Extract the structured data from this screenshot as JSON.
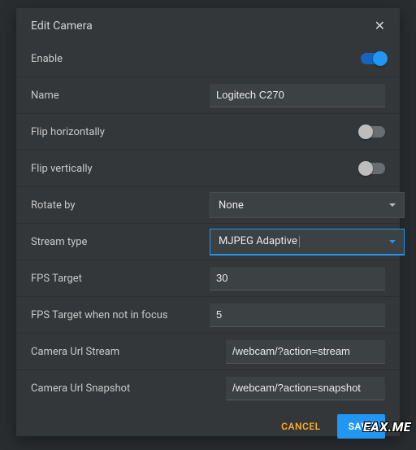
{
  "dialog": {
    "title": "Edit Camera",
    "close_icon": "close-icon"
  },
  "fields": {
    "enable": {
      "label": "Enable",
      "value": true
    },
    "name": {
      "label": "Name",
      "value": "Logitech C270"
    },
    "flip_h": {
      "label": "Flip horizontally",
      "value": false
    },
    "flip_v": {
      "label": "Flip vertically",
      "value": false
    },
    "rotate": {
      "label": "Rotate by",
      "value": "None"
    },
    "stream_type": {
      "label": "Stream type",
      "value": "MJPEG Adaptive"
    },
    "fps": {
      "label": "FPS Target",
      "value": "30"
    },
    "fps_unfocus": {
      "label": "FPS Target when not in focus",
      "value": "5"
    },
    "url_stream": {
      "label": "Camera Url Stream",
      "value": "/webcam/?action=stream"
    },
    "url_snapshot": {
      "label": "Camera Url Snapshot",
      "value": "/webcam/?action=snapshot"
    }
  },
  "actions": {
    "cancel": "CANCEL",
    "save": "SAVE"
  },
  "watermark": "EAX.ME"
}
